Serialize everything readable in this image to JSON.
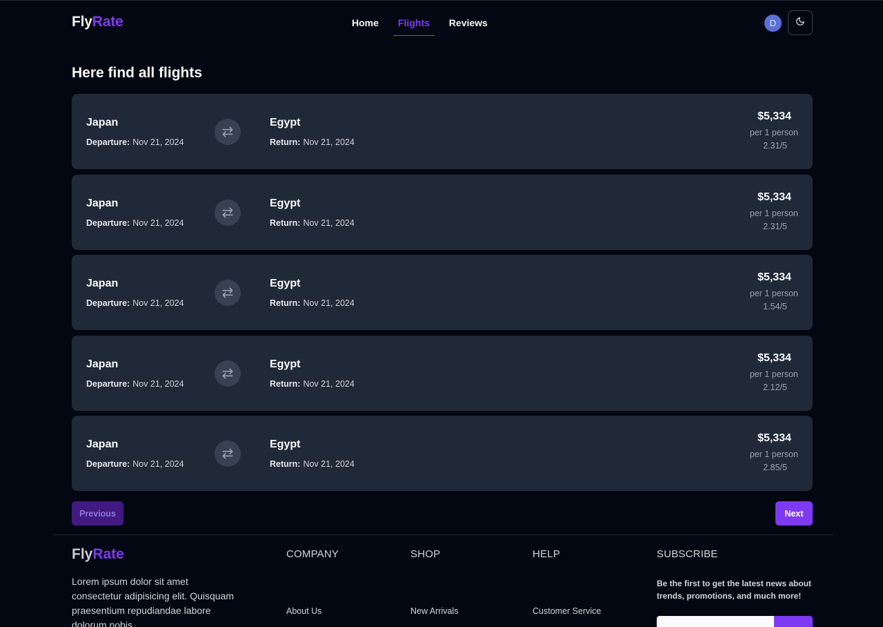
{
  "header": {
    "logo_part1": "Fly",
    "logo_part2": "Rate",
    "nav": [
      {
        "label": "Home",
        "active": false
      },
      {
        "label": "Flights",
        "active": true
      },
      {
        "label": "Reviews",
        "active": false
      }
    ],
    "avatar_initial": "D",
    "theme_icon": "moon-icon"
  },
  "main": {
    "title": "Here find all flights",
    "departure_label": "Departure:",
    "return_label": "Return:",
    "flights": [
      {
        "from": "Japan",
        "to": "Egypt",
        "departure": "Nov 21, 2024",
        "return": "Nov 21, 2024",
        "price": "$5,334",
        "per": "per 1 person",
        "rating": "2.31/5"
      },
      {
        "from": "Japan",
        "to": "Egypt",
        "departure": "Nov 21, 2024",
        "return": "Nov 21, 2024",
        "price": "$5,334",
        "per": "per 1 person",
        "rating": "2.31/5"
      },
      {
        "from": "Japan",
        "to": "Egypt",
        "departure": "Nov 21, 2024",
        "return": "Nov 21, 2024",
        "price": "$5,334",
        "per": "per 1 person",
        "rating": "1.54/5"
      },
      {
        "from": "Japan",
        "to": "Egypt",
        "departure": "Nov 21, 2024",
        "return": "Nov 21, 2024",
        "price": "$5,334",
        "per": "per 1 person",
        "rating": "2.12/5"
      },
      {
        "from": "Japan",
        "to": "Egypt",
        "departure": "Nov 21, 2024",
        "return": "Nov 21, 2024",
        "price": "$5,334",
        "per": "per 1 person",
        "rating": "2.85/5"
      }
    ]
  },
  "pagination": {
    "previous_label": "Previous",
    "next_label": "Next"
  },
  "footer": {
    "logo_part1": "Fly",
    "logo_part2": "Rate",
    "description": "Lorem ipsum dolor sit amet consectetur adipisicing elit. Quisquam praesentium repudiandae labore dolorum nobis",
    "company": {
      "heading": "COMPANY",
      "link": "About Us"
    },
    "shop": {
      "heading": "SHOP",
      "link": "New Arrivals"
    },
    "help": {
      "heading": "HELP",
      "link": "Customer Service"
    },
    "subscribe": {
      "heading": "SUBSCRIBE",
      "text": "Be the first to get the latest news about trends, promotions, and much more!",
      "input_value": "",
      "button_label": ""
    }
  },
  "colors": {
    "background": "#030712",
    "card": "#1f2937",
    "accent": "#7e3af2"
  }
}
